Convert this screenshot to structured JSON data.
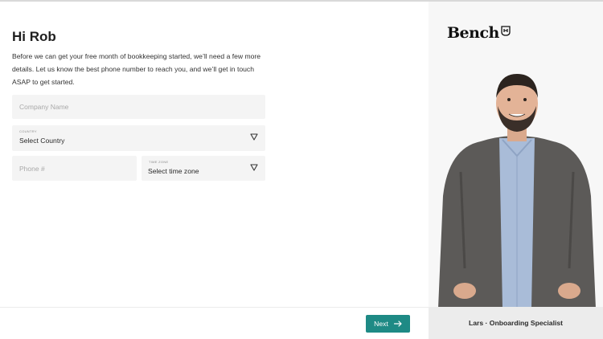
{
  "form": {
    "greeting": "Hi Rob",
    "intro": "Before we can get your free month of bookkeeping started, we’ll need a few more details. Let us know the best phone number to reach you, and we’ll get in touch ASAP to get started.",
    "company_placeholder": "Company Name",
    "country_label": "COUNTRY",
    "country_value": "Select Country",
    "phone_placeholder": "Phone #",
    "timezone_label": "TIME ZONE",
    "timezone_value": "Select time zone"
  },
  "footer": {
    "next_label": "Next",
    "next_color": "#1e8a85"
  },
  "brand": {
    "logo_text": "Bench"
  },
  "specialist": {
    "caption": "Lars · Onboarding Specialist"
  },
  "icons": {
    "dropdown": "chevron-down-icon",
    "next": "arrow-right-icon",
    "logo_mark": "bench-badge-icon"
  }
}
